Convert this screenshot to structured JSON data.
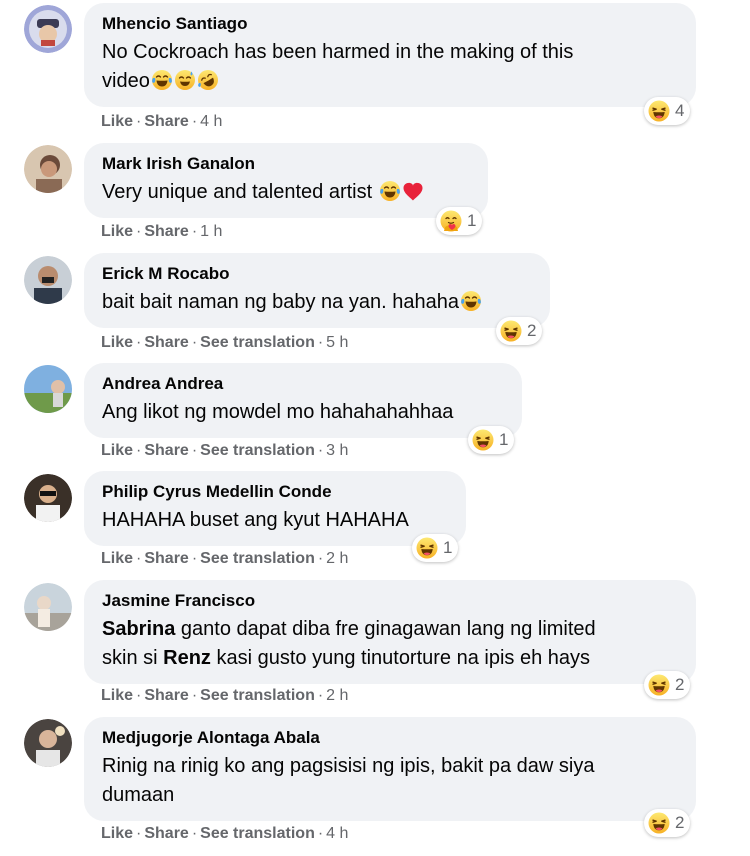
{
  "colors": {
    "bubble": "#f0f2f5",
    "meta_text": "#65676b",
    "name_text": "#050505",
    "haha": "#f7b125"
  },
  "icons": [
    "haha-reaction-icon",
    "care-reaction-icon",
    "tears-of-joy-emoji",
    "grinning-sweat-emoji",
    "rolling-laughing-emoji",
    "red-heart-emoji"
  ],
  "comments": [
    {
      "author": "Mhencio Santiago",
      "line1": "No Cockroach has been harmed in the making of this",
      "line2": "video",
      "like": "Like",
      "share": "Share",
      "time": "4 h",
      "reaction_count": "4"
    },
    {
      "author": "Mark Irish Ganalon",
      "text": "Very unique and talented artist",
      "like": "Like",
      "share": "Share",
      "time": "1 h",
      "reaction_count": "1"
    },
    {
      "author": "Erick M Rocabo",
      "text": "bait bait naman ng baby na yan. hahaha",
      "like": "Like",
      "share": "Share",
      "translate": "See translation",
      "time": "5 h",
      "reaction_count": "2"
    },
    {
      "author": "Andrea Andrea",
      "text": "Ang likot ng mowdel mo hahahahahhaa",
      "like": "Like",
      "share": "Share",
      "translate": "See translation",
      "time": "3 h",
      "reaction_count": "1"
    },
    {
      "author": "Philip Cyrus Medellin Conde",
      "text": "HAHAHA buset ang kyut HAHAHA",
      "like": "Like",
      "share": "Share",
      "translate": "See translation",
      "time": "2 h",
      "reaction_count": "1"
    },
    {
      "author": "Jasmine Francisco",
      "mention1": "Sabrina",
      "text1": " ganto dapat diba fre ginagawan lang ng limited",
      "text2a": "skin si ",
      "mention2": "Renz",
      "text2b": " kasi gusto yung tinutorture na ipis eh hays",
      "like": "Like",
      "share": "Share",
      "translate": "See translation",
      "time": "2 h",
      "reaction_count": "2"
    },
    {
      "author": "Medjugorje Alontaga Abala",
      "line1": "Rinig na rinig ko ang pagsisisi ng ipis, bakit pa daw siya",
      "line2": "dumaan",
      "like": "Like",
      "share": "Share",
      "translate": "See translation",
      "time": "4 h",
      "reaction_count": "2"
    }
  ]
}
